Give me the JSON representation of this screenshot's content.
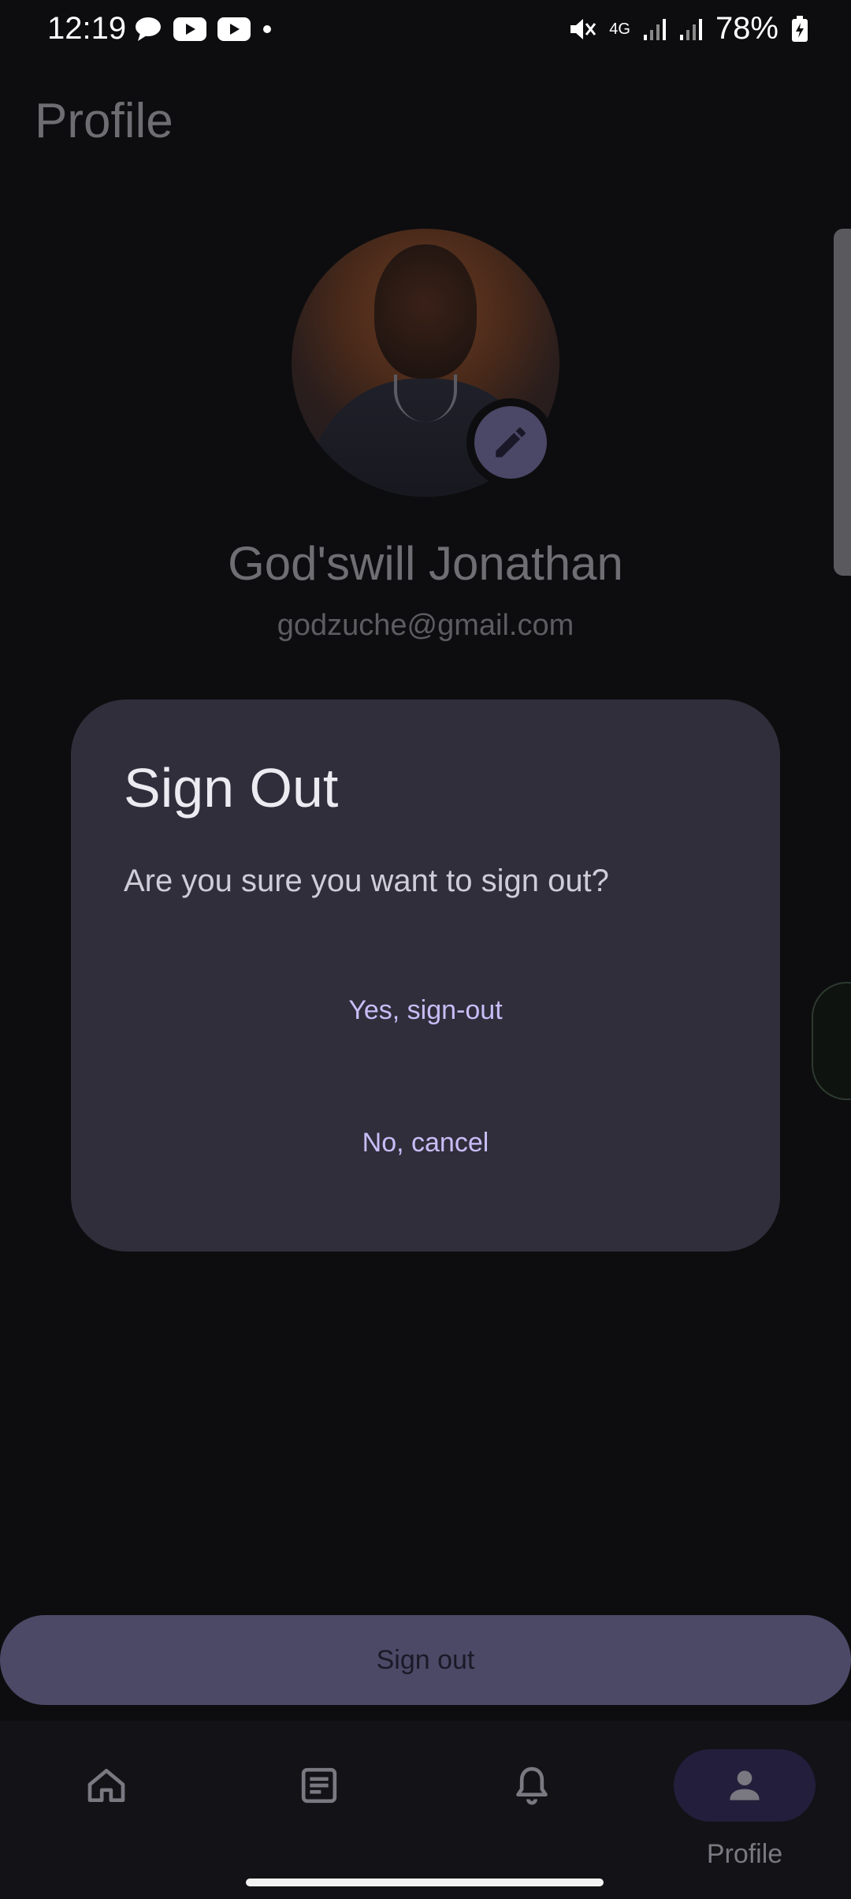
{
  "status_bar": {
    "time": "12:19",
    "network": "4G",
    "battery": "78%"
  },
  "header": {
    "title": "Profile"
  },
  "profile": {
    "name": "God'swill Jonathan",
    "email": "godzuche@gmail.com"
  },
  "dialog": {
    "title": "Sign Out",
    "message": "Are you sure you want to sign out?",
    "confirm_label": "Yes, sign-out",
    "cancel_label": "No, cancel"
  },
  "sign_out_button": {
    "label": "Sign out"
  },
  "bottom_nav": {
    "items": [
      {
        "icon": "home-icon",
        "label": ""
      },
      {
        "icon": "article-icon",
        "label": ""
      },
      {
        "icon": "bell-icon",
        "label": ""
      },
      {
        "icon": "person-icon",
        "label": "Profile",
        "active": true
      }
    ]
  },
  "colors": {
    "background": "#0d0d0f",
    "dialog": "#302e3b",
    "accent": "#c9bdf7",
    "button": "#4c4967"
  }
}
